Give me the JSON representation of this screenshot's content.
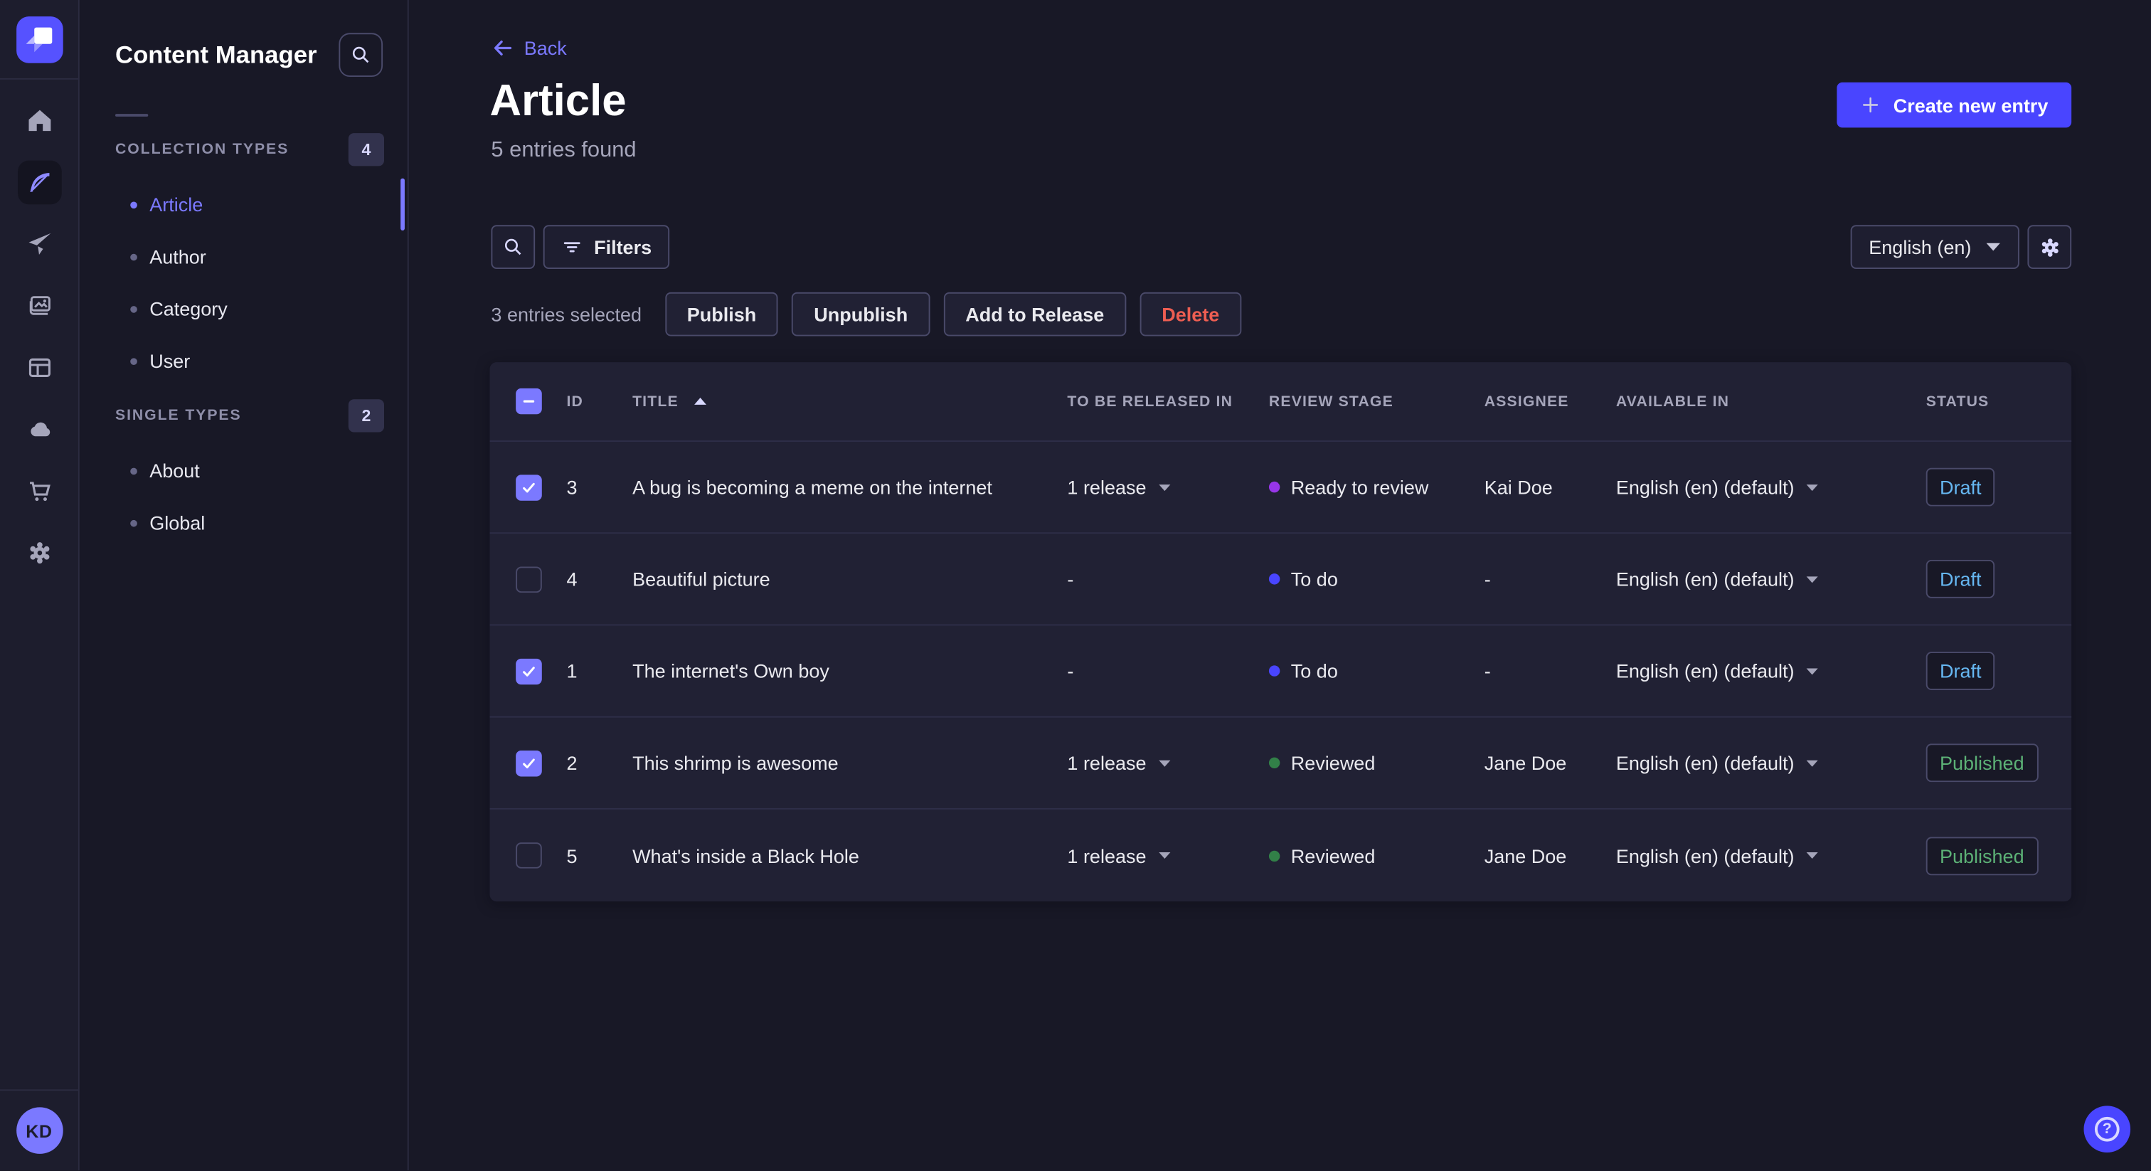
{
  "theme": {
    "bg": "#181826",
    "surface": "#212134",
    "rail_bg": "#1d1d2d",
    "border": "#32324d",
    "border_strong": "#4a4a6a",
    "text": "#eaeaef",
    "text_muted": "#a5a5ba",
    "primary": "#4945ff",
    "primary_light": "#7b79ff",
    "danger": "#ee5e52",
    "success": "#5cb176",
    "draft_blue": "#66b7f1"
  },
  "rail": {
    "icons": [
      "home-icon",
      "content-manager-icon",
      "releases-icon",
      "media-library-icon",
      "content-type-builder-icon",
      "deploy-icon",
      "marketplace-icon",
      "settings-icon"
    ],
    "active_icon": "content-manager-icon",
    "avatar_initials": "KD"
  },
  "sidebar": {
    "title": "Content Manager",
    "search_icon": "search-icon",
    "sections": [
      {
        "label": "COLLECTION TYPES",
        "count": "4",
        "items": [
          {
            "label": "Article",
            "active": true
          },
          {
            "label": "Author"
          },
          {
            "label": "Category"
          },
          {
            "label": "User"
          }
        ]
      },
      {
        "label": "SINGLE TYPES",
        "count": "2",
        "items": [
          {
            "label": "About"
          },
          {
            "label": "Global"
          }
        ]
      }
    ]
  },
  "header": {
    "back": "Back",
    "title": "Article",
    "subtitle": "5 entries found",
    "create": "Create new entry"
  },
  "toolbar": {
    "filters": "Filters",
    "locale": "English (en)"
  },
  "selection": {
    "label": "3 entries selected",
    "actions": [
      {
        "label": "Publish"
      },
      {
        "label": "Unpublish"
      },
      {
        "label": "Add to Release"
      },
      {
        "label": "Delete",
        "variant": "danger"
      }
    ]
  },
  "table": {
    "columns": [
      {
        "label": "ID"
      },
      {
        "label": "TITLE",
        "sorted": "asc"
      },
      {
        "label": "TO BE RELEASED IN"
      },
      {
        "label": "REVIEW STAGE"
      },
      {
        "label": "ASSIGNEE"
      },
      {
        "label": "AVAILABLE IN"
      },
      {
        "label": "STATUS"
      }
    ],
    "rows": [
      {
        "checked": true,
        "id": "3",
        "title": "A bug is becoming a meme on the internet",
        "release": "1 release",
        "stage": "Ready to review",
        "stage_color": "#9736e8",
        "assignee": "Kai Doe",
        "available": "English (en) (default)",
        "status": "Draft",
        "status_color": "#66b7f1"
      },
      {
        "checked": false,
        "id": "4",
        "title": "Beautiful picture",
        "release": "-",
        "stage": "To do",
        "stage_color": "#4945ff",
        "assignee": "-",
        "available": "English (en) (default)",
        "status": "Draft",
        "status_color": "#66b7f1"
      },
      {
        "checked": true,
        "id": "1",
        "title": "The internet's Own boy",
        "release": "-",
        "stage": "To do",
        "stage_color": "#4945ff",
        "assignee": "-",
        "available": "English (en) (default)",
        "status": "Draft",
        "status_color": "#66b7f1"
      },
      {
        "checked": true,
        "id": "2",
        "title": "This shrimp is awesome",
        "release": "1 release",
        "stage": "Reviewed",
        "stage_color": "#328048",
        "assignee": "Jane Doe",
        "available": "English (en) (default)",
        "status": "Published",
        "status_color": "#5cb176"
      },
      {
        "checked": false,
        "id": "5",
        "title": "What's inside a Black Hole",
        "release": "1 release",
        "stage": "Reviewed",
        "stage_color": "#328048",
        "assignee": "Jane Doe",
        "available": "English (en) (default)",
        "status": "Published",
        "status_color": "#5cb176"
      }
    ]
  },
  "help": {
    "glyph": "?"
  }
}
